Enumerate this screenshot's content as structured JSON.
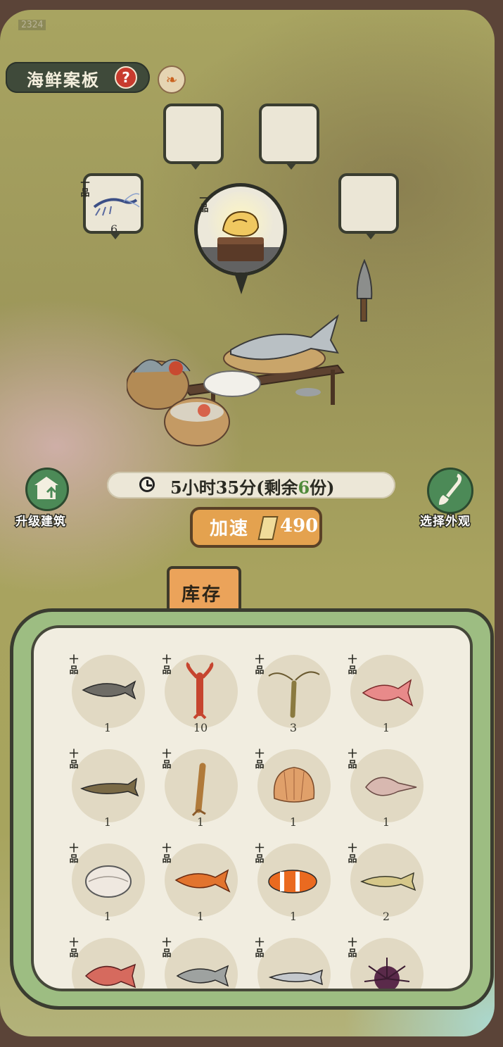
{
  "corner_tag": "2324",
  "header": {
    "title": "海鲜案板",
    "help_icon": "?",
    "phoenix_icon": "phoenix-icon"
  },
  "slots": {
    "left": {
      "grade": "一品",
      "count": "6",
      "content": "shrimp"
    },
    "center": {
      "grade": "一品",
      "content": "fish-steak-on-board"
    }
  },
  "timer": {
    "text_a": "5小时35分(剩余",
    "remaining": "6",
    "text_b": "份)"
  },
  "actions": {
    "upgrade_label": "升级建筑",
    "appearance_label": "选择外观",
    "speed_label": "加速",
    "speed_cost": "490"
  },
  "inventory": {
    "tab_label": "库存",
    "items": [
      {
        "name": "fish",
        "grade": "十品",
        "count": "1"
      },
      {
        "name": "crayfish",
        "grade": "十品",
        "count": "10"
      },
      {
        "name": "shrimp",
        "grade": "十品",
        "count": "3"
      },
      {
        "name": "red-goldfish",
        "grade": "十品",
        "count": "1"
      },
      {
        "name": "catfish",
        "grade": "十品",
        "count": "1"
      },
      {
        "name": "mantis-shrimp",
        "grade": "十品",
        "count": "1"
      },
      {
        "name": "scallop",
        "grade": "十品",
        "count": "1"
      },
      {
        "name": "conch",
        "grade": "十品",
        "count": "1"
      },
      {
        "name": "clam",
        "grade": "十品",
        "count": "1"
      },
      {
        "name": "carp",
        "grade": "十品",
        "count": "1"
      },
      {
        "name": "clownfish",
        "grade": "十品",
        "count": "1"
      },
      {
        "name": "yellow-croaker",
        "grade": "十品",
        "count": "2"
      },
      {
        "name": "red-snapper",
        "grade": "十品",
        "count": ""
      },
      {
        "name": "silver-carp",
        "grade": "十品",
        "count": ""
      },
      {
        "name": "anchovy",
        "grade": "十品",
        "count": ""
      },
      {
        "name": "sea-urchin",
        "grade": "十品",
        "count": ""
      }
    ]
  }
}
